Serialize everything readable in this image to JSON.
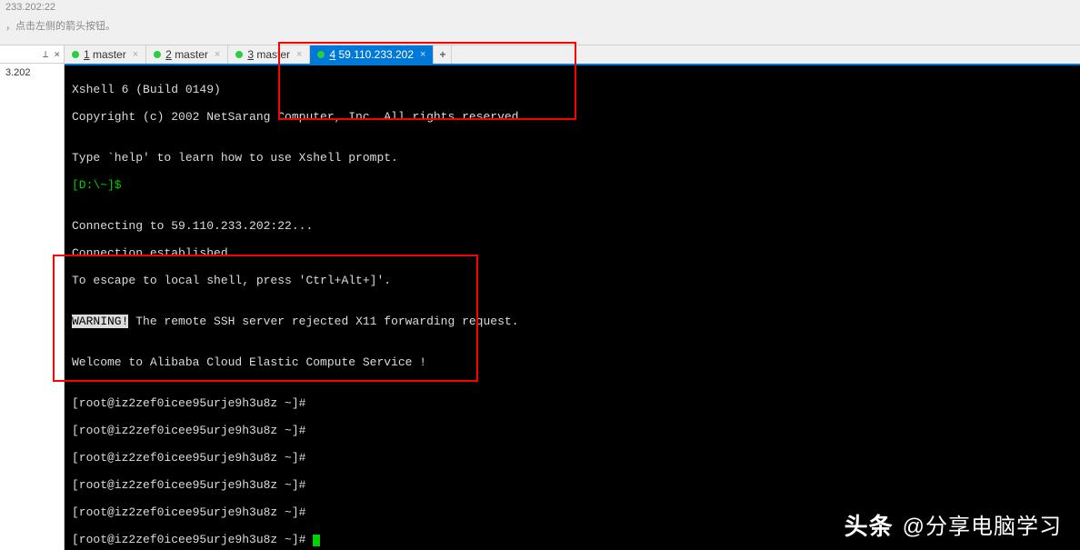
{
  "top": {
    "title": "233.202:22",
    "hint": "，点击左侧的箭头按钮。"
  },
  "leftPanel": {
    "pin": "⊥",
    "close": "×",
    "item": "3.202"
  },
  "tabs": [
    {
      "num": "1",
      "label": "master",
      "active": false
    },
    {
      "num": "2",
      "label": "master",
      "active": false
    },
    {
      "num": "3",
      "label": "master",
      "active": false
    },
    {
      "num": "4",
      "label": "59.110.233.202",
      "active": true
    }
  ],
  "tabAdd": "+",
  "terminal": {
    "l1": "Xshell 6 (Build 0149)",
    "l2": "Copyright (c) 2002 NetSarang Computer, Inc. All rights reserved.",
    "l3": "",
    "l4": "Type `help' to learn how to use Xshell prompt.",
    "prompt1": "[D:\\~]$ ",
    "l5": "",
    "l6": "Connecting to 59.110.233.202:22...",
    "l7": "Connection established.",
    "l8": "To escape to local shell, press 'Ctrl+Alt+]'.",
    "l9": "",
    "warn": "WARNING!",
    "l10": " The remote SSH server rejected X11 forwarding request.",
    "l11": "",
    "l12": "Welcome to Alibaba Cloud Elastic Compute Service !",
    "l13": "",
    "hostPrompt": "[root@iz2zef0icee95urje9h3u8z ~]# "
  },
  "watermark": {
    "logo": "头条",
    "text": "@分享电脑学习"
  }
}
